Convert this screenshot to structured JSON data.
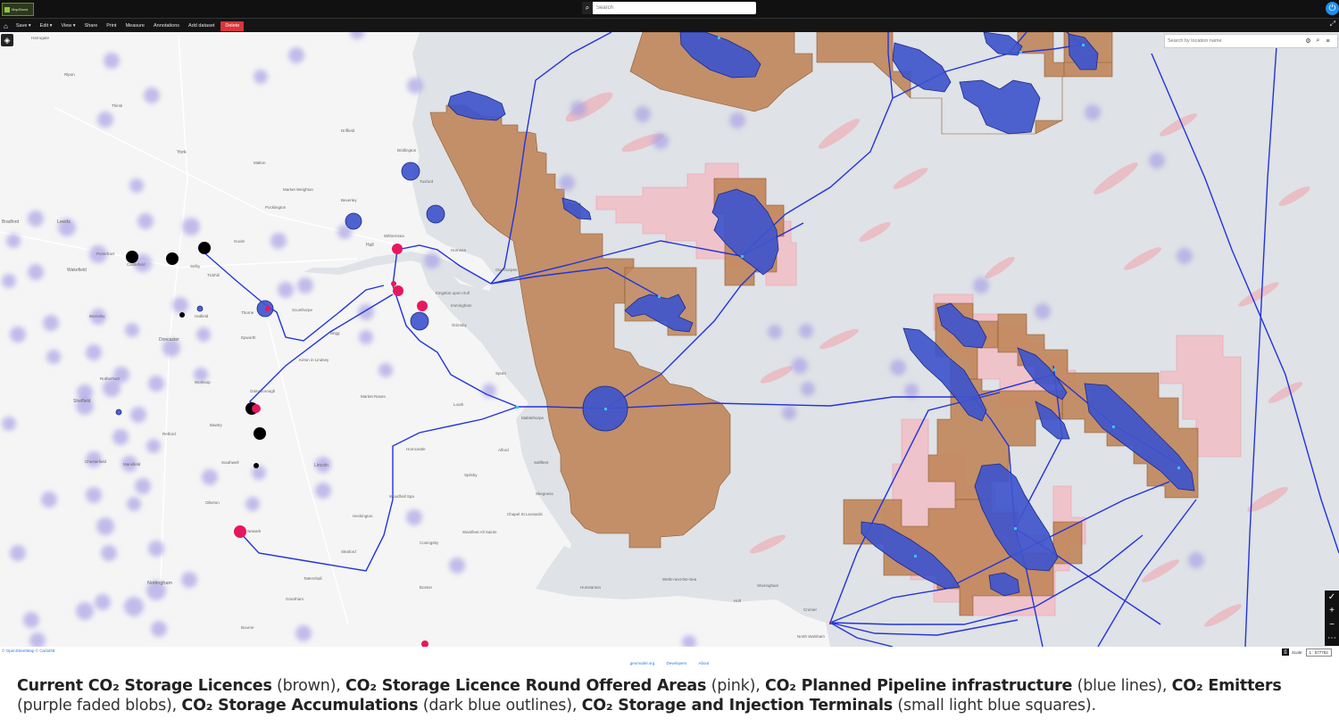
{
  "app": {
    "logo_text": "MapStand"
  },
  "search": {
    "placeholder": "Search"
  },
  "menu": {
    "items": [
      "Save ▾",
      "Edit ▾",
      "View ▾",
      "Share",
      "Print",
      "Measure",
      "Annotations",
      "Add dataset"
    ],
    "delete_label": "Delete"
  },
  "location_search": {
    "placeholder": "Search by location name"
  },
  "map_labels": {
    "places": [
      "Harrogate",
      "Ripon",
      "Thirsk",
      "York",
      "Leeds",
      "Bradford",
      "Wakefield",
      "Pontefract",
      "Barnsley",
      "Doncaster",
      "Rotherham",
      "Sheffield",
      "Chesterfield",
      "Mansfield",
      "Nottingham",
      "Worksop",
      "Newark",
      "Lincoln",
      "Gainsborough",
      "Hull",
      "Beverley",
      "Goole",
      "Selby",
      "Scunthorpe",
      "Grimsby",
      "Louth",
      "Skegness",
      "Boston",
      "Sleaford",
      "Grantham",
      "Hunstanton",
      "Wells-next-the-Sea",
      "Cromer",
      "Sheringham",
      "Holt",
      "Driffield",
      "Bridlington",
      "Malton",
      "Pocklington",
      "Market Weighton",
      "North Walsham",
      "Castleford",
      "Hatfield",
      "Brigg",
      "Market Rasen",
      "Horncastle",
      "Spilsby",
      "Mablethorpe",
      "Alford",
      "Woodhall Spa",
      "Kirton in Lindsey",
      "Retford",
      "Tickhill",
      "Thorne",
      "Epworth",
      "Bawtry",
      "Ollerton",
      "Southwell",
      "Tuxford",
      "Hornsea",
      "Withernsea",
      "Kingston upon Hull",
      "Immingham",
      "Cleethorpes",
      "Spurn",
      "Saltfleet",
      "Chapel St Leonards",
      "Wainfleet All Saints",
      "Heckington",
      "Coningsby",
      "Tattershall",
      "Bourne"
    ]
  },
  "attribution": {
    "prefix": "© ",
    "osm": "OpenStreetMap",
    "sep": " © ",
    "carto": "CartoDB"
  },
  "scale": {
    "label": "Scale:",
    "value": "1 : 577752"
  },
  "footer": {
    "links": [
      "geomodel.org",
      "Developers",
      "About"
    ]
  },
  "caption": {
    "licences_bold": "Current CO₂ Storage Licences",
    "licences_rest": " (brown), ",
    "offered_bold": "CO₂ Storage Licence Round Offered Areas",
    "offered_rest": " (pink), ",
    "pipeline_bold": "CO₂ Planned Pipeline infrastructure",
    "pipeline_rest": " (blue lines), ",
    "emitters_bold": "CO₂ Emitters",
    "emitters_rest": " (purple faded blobs), ",
    "accum_bold": "CO₂ Storage Accumulations",
    "accum_rest": " (dark blue outlines), ",
    "terminals_bold": "CO₂ Storage and Injection Terminals",
    "terminals_rest": " (small light blue squares)."
  },
  "colors": {
    "licence": "#c0865a",
    "offered": "#f4b8c0",
    "pipeline": "#2233dd",
    "emitter": "#a9a3e6",
    "accumulation": "#3f55cc",
    "terminal": "#37c6e8",
    "sea": "#dfe2e6",
    "land": "#f5f5f5"
  },
  "icons": [
    "search-icon",
    "power-icon",
    "home-icon",
    "layers-icon",
    "gear-icon",
    "menu-icon",
    "zoom-in-icon",
    "zoom-out-icon",
    "more-icon",
    "expand-icon",
    "print-icon"
  ]
}
